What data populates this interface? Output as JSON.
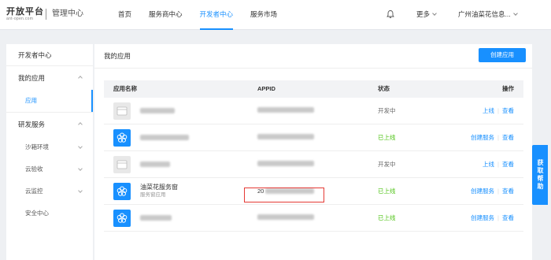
{
  "brand": {
    "logo_text": "开放平台",
    "logo_sub": "ant-open.com",
    "console": "管理中心"
  },
  "nav": {
    "items": [
      {
        "label": "首页",
        "active": false
      },
      {
        "label": "服务商中心",
        "active": false
      },
      {
        "label": "开发者中心",
        "active": true
      },
      {
        "label": "服务市场",
        "active": false
      }
    ]
  },
  "topright": {
    "bell_icon": "bell-icon",
    "more": "更多",
    "company": "广州油菜花信息..."
  },
  "sidebar": {
    "header": "开发者中心",
    "groups": [
      {
        "label": "我的应用",
        "expanded": true,
        "items": [
          {
            "label": "应用",
            "active": true
          }
        ]
      },
      {
        "label": "研发服务",
        "expanded": true,
        "items": [
          {
            "label": "沙箱环境",
            "has_chevron": true
          },
          {
            "label": "云验收",
            "has_chevron": true
          },
          {
            "label": "云监控",
            "has_chevron": true
          },
          {
            "label": "安全中心",
            "has_chevron": false
          }
        ]
      }
    ]
  },
  "main": {
    "title": "我的应用",
    "create_button": "创建应用",
    "columns": [
      "应用名称",
      "APPID",
      "状态",
      "操作"
    ],
    "rows": [
      {
        "icon": "grey",
        "name": "",
        "sub": "",
        "appid": "",
        "status": "开发中",
        "status_type": "dev",
        "ops": [
          "上线",
          "查看"
        ]
      },
      {
        "icon": "blue",
        "name": "",
        "sub": "",
        "appid": "",
        "status": "已上线",
        "status_type": "online",
        "ops": [
          "创建服务",
          "查看"
        ]
      },
      {
        "icon": "grey",
        "name": "",
        "sub": "",
        "appid": "",
        "status": "开发中",
        "status_type": "dev",
        "ops": [
          "上线",
          "查看"
        ]
      },
      {
        "icon": "blue",
        "name": "油菜花服务窗",
        "sub": "服务窗应用",
        "appid": "20",
        "status": "已上线",
        "status_type": "online",
        "ops": [
          "创建服务",
          "查看"
        ]
      },
      {
        "icon": "blue",
        "name": "",
        "sub": "",
        "appid": "",
        "status": "已上线",
        "status_type": "online",
        "ops": [
          "创建服务",
          "查看"
        ]
      }
    ]
  },
  "help": {
    "label": "获取帮助"
  },
  "colors": {
    "accent": "#1890ff",
    "online": "#52c41a",
    "highlight": "#e53935"
  }
}
